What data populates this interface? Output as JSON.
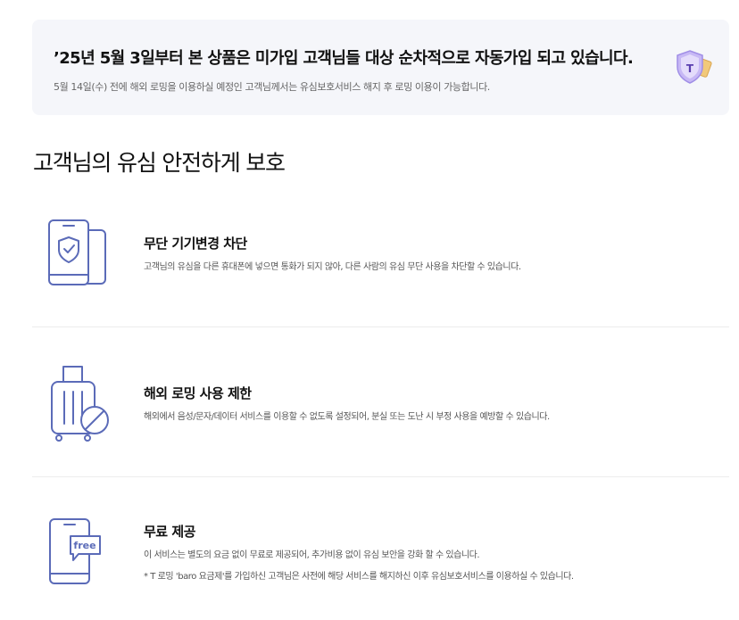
{
  "notice": {
    "title": "’25년 5월 3일부터 본 상품은 미가입 고객님들 대상 순차적으로 자동가입 되고 있습니다.",
    "subtitle": "5월 14일(수) 전에 해외 로밍을 이용하실 예정인 고객님께서는 유심보호서비스 해지 후 로밍 이용이 가능합니다.",
    "badge_icon": "t-shield-sim-icon",
    "badge_letter": "T"
  },
  "section": {
    "title": "고객님의 유심 안전하게 보호"
  },
  "features": [
    {
      "icon": "phone-shield-icon",
      "title": "무단 기기변경 차단",
      "description": "고객님의 유심을 다른 휴대폰에 넣으면 통화가 되지 않아, 다른 사람의 유심 무단 사용을 차단할 수 있습니다."
    },
    {
      "icon": "luggage-block-icon",
      "title": "해외 로밍 사용 제한",
      "description": "해외에서 음성/문자/데이터 서비스를 이용할 수 없도록 설정되어, 분실 또는 도난 시 부정 사용을 예방할 수 있습니다."
    },
    {
      "icon": "phone-free-icon",
      "title": "무료 제공",
      "description": "이 서비스는 별도의 요금 없이 무료로 제공되어, 추가비용 없이 유심 보안을 강화 할 수 있습니다.",
      "note": "* T 로밍 'baro 요금제'를 가입하신 고객님은 사전에 해당 서비스를 해지하신 이후 유심보호서비스를 이용하실 수 있습니다.",
      "icon_label": "free"
    }
  ],
  "colors": {
    "icon_stroke": "#5b6bb8",
    "notice_bg": "#f5f6fa",
    "badge_purple": "#b8a8f0"
  }
}
